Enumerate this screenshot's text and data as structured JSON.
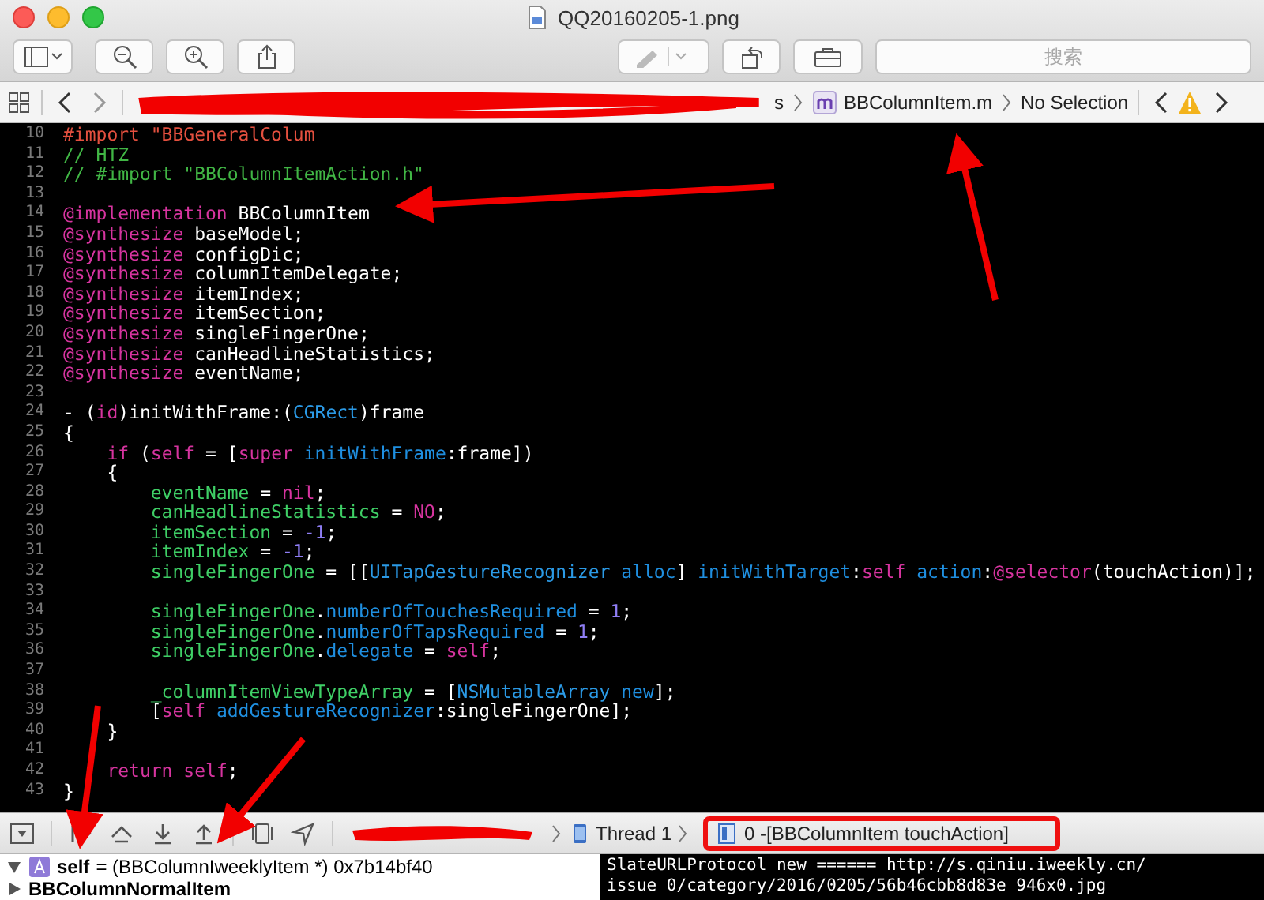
{
  "window": {
    "title": "QQ20160205-1.png"
  },
  "toolbar": {
    "search": {
      "placeholder": "搜索"
    }
  },
  "jump_bar": {
    "path_tail": "s",
    "file": "BBColumnItem.m",
    "selection": "No Selection"
  },
  "editor": {
    "lines": [
      {
        "number": "10",
        "tokens": [
          {
            "kind": "preproc",
            "text": "#import \"BBGeneralColum"
          }
        ]
      },
      {
        "number": "11",
        "tokens": [
          {
            "kind": "comment",
            "text": "// HTZ"
          }
        ]
      },
      {
        "number": "12",
        "tokens": [
          {
            "kind": "comment",
            "text": "// #import \"BBColumnItemAction.h\""
          }
        ]
      },
      {
        "number": "13"
      },
      {
        "number": "14",
        "tokens": [
          {
            "kind": "keyword",
            "text": "@implementation"
          },
          {
            "kind": "plain",
            "text": " BBColumnItem"
          }
        ]
      },
      {
        "number": "15",
        "tokens": [
          {
            "kind": "keyword",
            "text": "@synthesize"
          },
          {
            "kind": "plain",
            "text": " baseModel;"
          }
        ]
      },
      {
        "number": "16",
        "tokens": [
          {
            "kind": "keyword",
            "text": "@synthesize"
          },
          {
            "kind": "plain",
            "text": " configDic;"
          }
        ]
      },
      {
        "number": "17",
        "tokens": [
          {
            "kind": "keyword",
            "text": "@synthesize"
          },
          {
            "kind": "plain",
            "text": " columnItemDelegate;"
          }
        ]
      },
      {
        "number": "18",
        "tokens": [
          {
            "kind": "keyword",
            "text": "@synthesize"
          },
          {
            "kind": "plain",
            "text": " itemIndex;"
          }
        ]
      },
      {
        "number": "19",
        "tokens": [
          {
            "kind": "keyword",
            "text": "@synthesize"
          },
          {
            "kind": "plain",
            "text": " itemSection;"
          }
        ]
      },
      {
        "number": "20",
        "tokens": [
          {
            "kind": "keyword",
            "text": "@synthesize"
          },
          {
            "kind": "plain",
            "text": " singleFingerOne;"
          }
        ]
      },
      {
        "number": "21",
        "tokens": [
          {
            "kind": "keyword",
            "text": "@synthesize"
          },
          {
            "kind": "plain",
            "text": " canHeadlineStatistics;"
          }
        ]
      },
      {
        "number": "22",
        "tokens": [
          {
            "kind": "keyword",
            "text": "@synthesize"
          },
          {
            "kind": "plain",
            "text": " eventName;"
          }
        ]
      },
      {
        "number": "23"
      },
      {
        "number": "24",
        "tokens": [
          {
            "kind": "plain",
            "text": "- ("
          },
          {
            "kind": "keyword",
            "text": "id"
          },
          {
            "kind": "plain",
            "text": ")initWithFrame:("
          },
          {
            "kind": "type",
            "text": "CGRect"
          },
          {
            "kind": "plain",
            "text": ")frame"
          }
        ]
      },
      {
        "number": "25",
        "tokens": [
          {
            "kind": "plain",
            "text": "{"
          }
        ]
      },
      {
        "number": "26",
        "tokens": [
          {
            "kind": "keyword",
            "text": "    if"
          },
          {
            "kind": "plain",
            "text": " ("
          },
          {
            "kind": "keyword",
            "text": "self"
          },
          {
            "kind": "plain",
            "text": " = ["
          },
          {
            "kind": "keyword",
            "text": "super"
          },
          {
            "kind": "method",
            "text": " initWithFrame"
          },
          {
            "kind": "plain",
            "text": ":frame])"
          }
        ]
      },
      {
        "number": "27",
        "tokens": [
          {
            "kind": "plain",
            "text": "    {"
          }
        ]
      },
      {
        "number": "28",
        "tokens": [
          {
            "kind": "ivar",
            "text": "        eventName"
          },
          {
            "kind": "plain",
            "text": " = "
          },
          {
            "kind": "keyword",
            "text": "nil"
          },
          {
            "kind": "plain",
            "text": ";"
          }
        ]
      },
      {
        "number": "29",
        "tokens": [
          {
            "kind": "ivar",
            "text": "        canHeadlineStatistics"
          },
          {
            "kind": "plain",
            "text": " = "
          },
          {
            "kind": "keyword",
            "text": "NO"
          },
          {
            "kind": "plain",
            "text": ";"
          }
        ]
      },
      {
        "number": "30",
        "tokens": [
          {
            "kind": "ivar",
            "text": "        itemSection"
          },
          {
            "kind": "plain",
            "text": " = "
          },
          {
            "kind": "number",
            "text": "-1"
          },
          {
            "kind": "plain",
            "text": ";"
          }
        ]
      },
      {
        "number": "31",
        "tokens": [
          {
            "kind": "ivar",
            "text": "        itemIndex"
          },
          {
            "kind": "plain",
            "text": " = "
          },
          {
            "kind": "number",
            "text": "-1"
          },
          {
            "kind": "plain",
            "text": ";"
          }
        ]
      },
      {
        "number": "32",
        "tokens": [
          {
            "kind": "ivar",
            "text": "        singleFingerOne"
          },
          {
            "kind": "plain",
            "text": " = [["
          },
          {
            "kind": "type",
            "text": "UITapGestureRecognizer"
          },
          {
            "kind": "method",
            "text": " alloc"
          },
          {
            "kind": "plain",
            "text": "] "
          },
          {
            "kind": "method",
            "text": "initWithTarget"
          },
          {
            "kind": "plain",
            "text": ":"
          },
          {
            "kind": "keyword",
            "text": "self"
          },
          {
            "kind": "method",
            "text": " action"
          },
          {
            "kind": "plain",
            "text": ":"
          },
          {
            "kind": "keyword",
            "text": "@selector"
          },
          {
            "kind": "plain",
            "text": "(touchAction)];"
          }
        ]
      },
      {
        "number": "33"
      },
      {
        "number": "34",
        "tokens": [
          {
            "kind": "ivar",
            "text": "        singleFingerOne"
          },
          {
            "kind": "plain",
            "text": "."
          },
          {
            "kind": "method",
            "text": "numberOfTouchesRequired"
          },
          {
            "kind": "plain",
            "text": " = "
          },
          {
            "kind": "number",
            "text": "1"
          },
          {
            "kind": "plain",
            "text": ";"
          }
        ]
      },
      {
        "number": "35",
        "tokens": [
          {
            "kind": "ivar",
            "text": "        singleFingerOne"
          },
          {
            "kind": "plain",
            "text": "."
          },
          {
            "kind": "method",
            "text": "numberOfTapsRequired"
          },
          {
            "kind": "plain",
            "text": " = "
          },
          {
            "kind": "number",
            "text": "1"
          },
          {
            "kind": "plain",
            "text": ";"
          }
        ]
      },
      {
        "number": "36",
        "tokens": [
          {
            "kind": "ivar",
            "text": "        singleFingerOne"
          },
          {
            "kind": "plain",
            "text": "."
          },
          {
            "kind": "method",
            "text": "delegate"
          },
          {
            "kind": "plain",
            "text": " = "
          },
          {
            "kind": "keyword",
            "text": "self"
          },
          {
            "kind": "plain",
            "text": ";"
          }
        ]
      },
      {
        "number": "37"
      },
      {
        "number": "38",
        "tokens": [
          {
            "kind": "ivar",
            "text": "        _columnItemViewTypeArray"
          },
          {
            "kind": "plain",
            "text": " = ["
          },
          {
            "kind": "type",
            "text": "NSMutableArray"
          },
          {
            "kind": "method",
            "text": " new"
          },
          {
            "kind": "plain",
            "text": "];"
          }
        ]
      },
      {
        "number": "39",
        "tokens": [
          {
            "kind": "plain",
            "text": "        ["
          },
          {
            "kind": "keyword",
            "text": "self"
          },
          {
            "kind": "method",
            "text": " addGestureRecognizer"
          },
          {
            "kind": "plain",
            "text": ":singleFingerOne];"
          }
        ]
      },
      {
        "number": "40",
        "tokens": [
          {
            "kind": "plain",
            "text": "    }"
          }
        ]
      },
      {
        "number": "41"
      },
      {
        "number": "42",
        "tokens": [
          {
            "kind": "keyword",
            "text": "    return"
          },
          {
            "kind": "keyword",
            "text": " self"
          },
          {
            "kind": "plain",
            "text": ";"
          }
        ]
      },
      {
        "number": "43",
        "tokens": [
          {
            "kind": "plain",
            "text": "}"
          }
        ]
      }
    ]
  },
  "debug_bar": {
    "thread": "Thread 1",
    "frame": "0 -[BBColumnItem touchAction]"
  },
  "variables": [
    {
      "name": "self",
      "detail": "= (BBColumnIweeklyItem *) 0x7b14bf40",
      "expanded": true
    },
    {
      "name": "BBColumnNormalItem",
      "expanded": false
    }
  ],
  "console": {
    "lines": [
      "SlateURLProtocol new ====== http://s.qiniu.iweekly.cn/",
      "issue_0/category/2016/0205/56b46cbb8d83e_946x0.jpg"
    ]
  }
}
